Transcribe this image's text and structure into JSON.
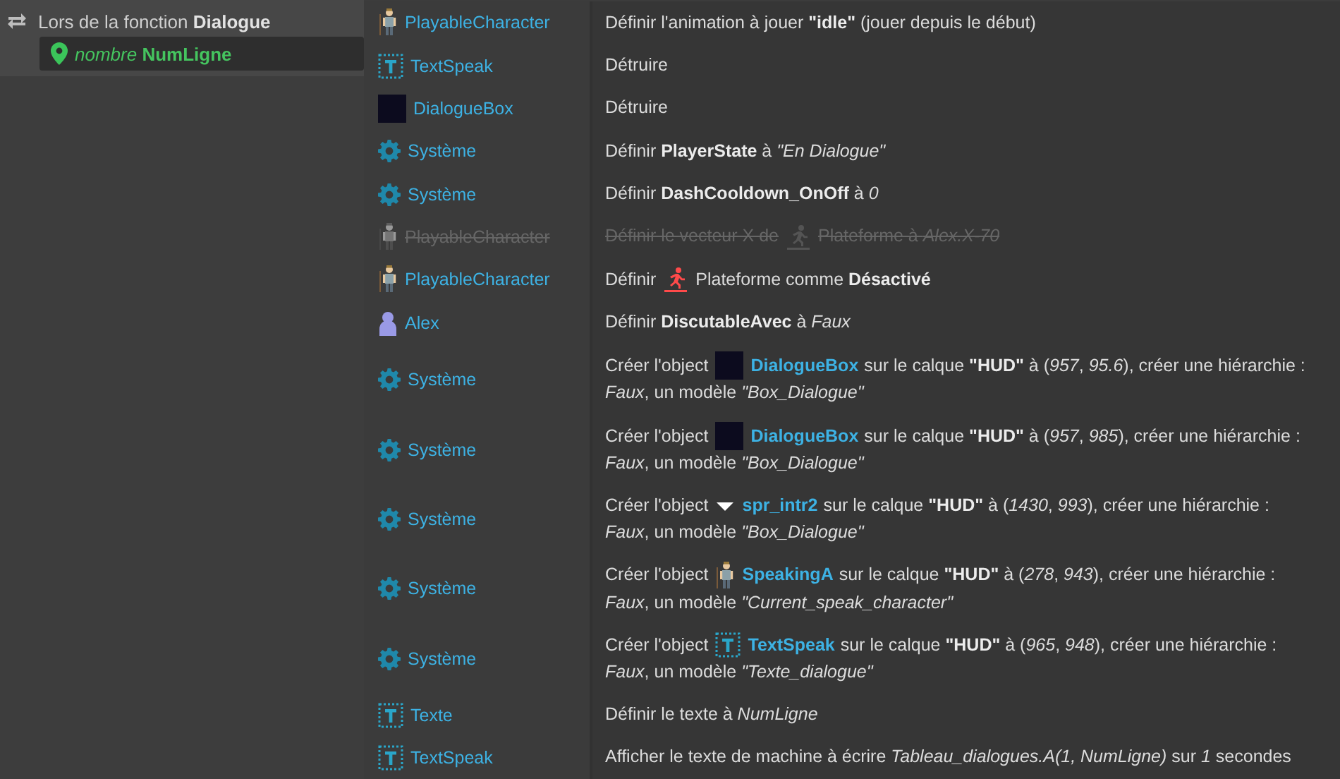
{
  "event": {
    "title": "Lors de la fonction **Dialogue**",
    "parameter": {
      "label": "*nombre* **NumLigne**"
    }
  },
  "actions": [
    {
      "object": {
        "kind": "character",
        "name": "PlayableCharacter"
      },
      "disabled": false,
      "parts": [
        {
          "kind": "text",
          "text": "Définir l'animation à jouer **\"idle\"** (jouer depuis le début)"
        }
      ]
    },
    {
      "object": {
        "kind": "text-object",
        "name": "TextSpeak"
      },
      "disabled": false,
      "parts": [
        {
          "kind": "text",
          "text": "Détruire"
        }
      ]
    },
    {
      "object": {
        "kind": "box",
        "name": "DialogueBox"
      },
      "disabled": false,
      "parts": [
        {
          "kind": "text",
          "text": "Détruire"
        }
      ]
    },
    {
      "object": {
        "kind": "system",
        "name": "Système"
      },
      "disabled": false,
      "parts": [
        {
          "kind": "text",
          "text": "Définir **PlayerState** à *\"En Dialogue\"*"
        }
      ]
    },
    {
      "object": {
        "kind": "system",
        "name": "Système"
      },
      "disabled": false,
      "parts": [
        {
          "kind": "text",
          "text": "Définir **DashCooldown_OnOff** à *0*"
        }
      ]
    },
    {
      "object": {
        "kind": "character",
        "name": "PlayableCharacter"
      },
      "disabled": true,
      "parts": [
        {
          "kind": "text",
          "text": "Définir le vecteur X de"
        },
        {
          "kind": "platform"
        },
        {
          "kind": "text",
          "text": "Plateforme à *Alex.X-70*"
        }
      ]
    },
    {
      "object": {
        "kind": "character",
        "name": "PlayableCharacter"
      },
      "disabled": false,
      "parts": [
        {
          "kind": "text",
          "text": "Définir"
        },
        {
          "kind": "platform"
        },
        {
          "kind": "text",
          "text": "Plateforme comme **Désactivé**"
        }
      ]
    },
    {
      "object": {
        "kind": "person",
        "name": "Alex"
      },
      "disabled": false,
      "parts": [
        {
          "kind": "text",
          "text": "Définir **DiscutableAvec** à *Faux*"
        }
      ]
    },
    {
      "object": {
        "kind": "system",
        "name": "Système"
      },
      "disabled": false,
      "parts": [
        {
          "kind": "text",
          "text": "Créer l'object"
        },
        {
          "kind": "box",
          "text": "DialogueBox"
        },
        {
          "kind": "text",
          "text": "sur le calque **\"HUD\"** à (*957*, *95.6*), créer une hiérarchie :"
        },
        {
          "kind": "line",
          "text": "*Faux*, un modèle *\"Box_Dialogue\"*"
        }
      ]
    },
    {
      "object": {
        "kind": "system",
        "name": "Système"
      },
      "disabled": false,
      "parts": [
        {
          "kind": "text",
          "text": "Créer l'object"
        },
        {
          "kind": "box",
          "text": "DialogueBox"
        },
        {
          "kind": "text",
          "text": "sur le calque **\"HUD\"** à (*957*, *985*), créer une hiérarchie :"
        },
        {
          "kind": "line",
          "text": "*Faux*, un modèle *\"Box_Dialogue\"*"
        }
      ]
    },
    {
      "object": {
        "kind": "system",
        "name": "Système"
      },
      "disabled": false,
      "parts": [
        {
          "kind": "text",
          "text": "Créer l'object"
        },
        {
          "kind": "arrow",
          "text": "spr_intr2"
        },
        {
          "kind": "text",
          "text": "sur le calque **\"HUD\"** à (*1430*, *993*), créer une hiérarchie :"
        },
        {
          "kind": "line",
          "text": "*Faux*, un modèle *\"Box_Dialogue\"*"
        }
      ]
    },
    {
      "object": {
        "kind": "system",
        "name": "Système"
      },
      "disabled": false,
      "parts": [
        {
          "kind": "text",
          "text": "Créer l'object"
        },
        {
          "kind": "character",
          "text": "SpeakingA"
        },
        {
          "kind": "text",
          "text": "sur le calque **\"HUD\"** à (*278*, *943*), créer une hiérarchie :"
        },
        {
          "kind": "line",
          "text": "*Faux*, un modèle *\"Current_speak_character\"*"
        }
      ]
    },
    {
      "object": {
        "kind": "system",
        "name": "Système"
      },
      "disabled": false,
      "parts": [
        {
          "kind": "text",
          "text": "Créer l'object"
        },
        {
          "kind": "text-object",
          "text": "TextSpeak"
        },
        {
          "kind": "text",
          "text": "sur le calque **\"HUD\"** à (*965*, *948*), créer une hiérarchie :"
        },
        {
          "kind": "line",
          "text": "*Faux*, un modèle *\"Texte_dialogue\"*"
        }
      ]
    },
    {
      "object": {
        "kind": "text-object",
        "name": "Texte"
      },
      "disabled": false,
      "parts": [
        {
          "kind": "text",
          "text": "Définir le texte à *NumLigne*"
        }
      ]
    },
    {
      "object": {
        "kind": "text-object",
        "name": "TextSpeak"
      },
      "disabled": false,
      "parts": [
        {
          "kind": "text",
          "text": "Afficher le texte de machine à écrire *Tableau_dialogues.A(1, NumLigne)* sur *1* secondes"
        }
      ]
    }
  ]
}
